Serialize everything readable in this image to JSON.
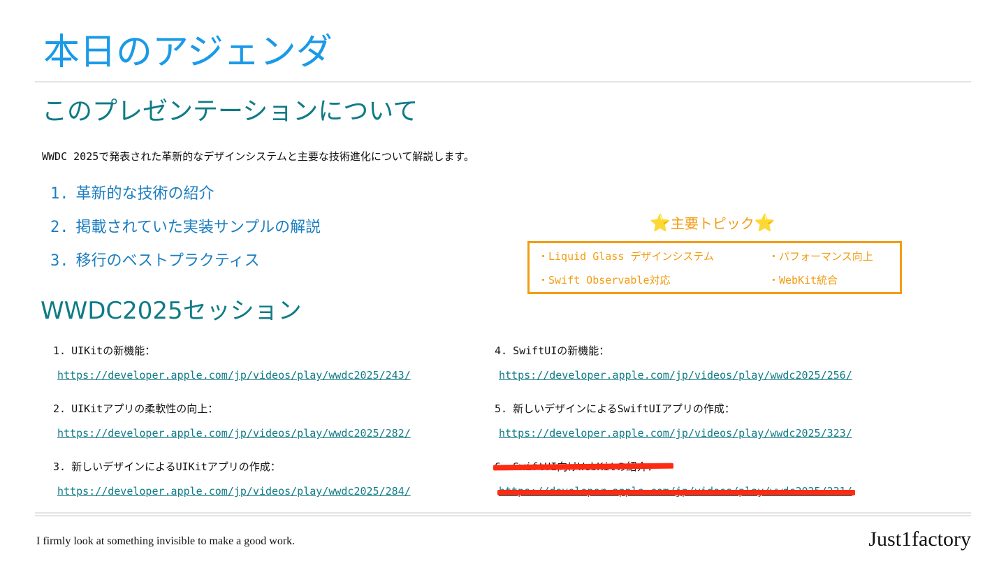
{
  "slide": {
    "title": "本日のアジェンダ"
  },
  "about": {
    "heading": "このプレゼンテーションについて",
    "intro": "WWDC 2025で発表された革新的なデザインシステムと主要な技術進化について解説します。",
    "agenda": [
      {
        "number": "1.",
        "label": "革新的な技術の紹介"
      },
      {
        "number": "2.",
        "label": "掲載されていた実装サンプルの解説"
      },
      {
        "number": "3.",
        "label": "移行のベストプラクティス"
      }
    ]
  },
  "topics": {
    "star": "⭐",
    "title": "主要トピック",
    "items": [
      "・Liquid Glass デザインシステム",
      "・パフォーマンス向上",
      "・Swift Observable対応",
      "・WebKit統合"
    ]
  },
  "sessions": {
    "heading": "WWDC2025セッション",
    "items": [
      {
        "number": "1.",
        "title": "UIKitの新機能：",
        "url": "https://developer.apple.com/jp/videos/play/wwdc2025/243/"
      },
      {
        "number": "2.",
        "title": "UIKitアプリの柔軟性の向上：",
        "url": "https://developer.apple.com/jp/videos/play/wwdc2025/282/"
      },
      {
        "number": "3.",
        "title": "新しいデザインによるUIKitアプリの作成：",
        "url": "https://developer.apple.com/jp/videos/play/wwdc2025/284/"
      },
      {
        "number": "4.",
        "title": "SwiftUIの新機能：",
        "url": "https://developer.apple.com/jp/videos/play/wwdc2025/256/"
      },
      {
        "number": "5.",
        "title": "新しいデザインによるSwiftUIアプリの作成：",
        "url": "https://developer.apple.com/jp/videos/play/wwdc2025/323/"
      },
      {
        "number": "6.",
        "title": "SwiftUI向けWebKitの紹介：",
        "url": "https://developer.apple.com/jp/videos/play/wwdc2025/231/",
        "struck_out": true
      }
    ]
  },
  "footer": {
    "tagline": "I firmly look at something invisible to make a good work.",
    "brand": "Just1factory"
  },
  "colors": {
    "title": "#1a9ae8",
    "heading": "#0f7b86",
    "agenda": "#1c7ec0",
    "topics": "#f39c12",
    "strike": "#ff2a12"
  }
}
